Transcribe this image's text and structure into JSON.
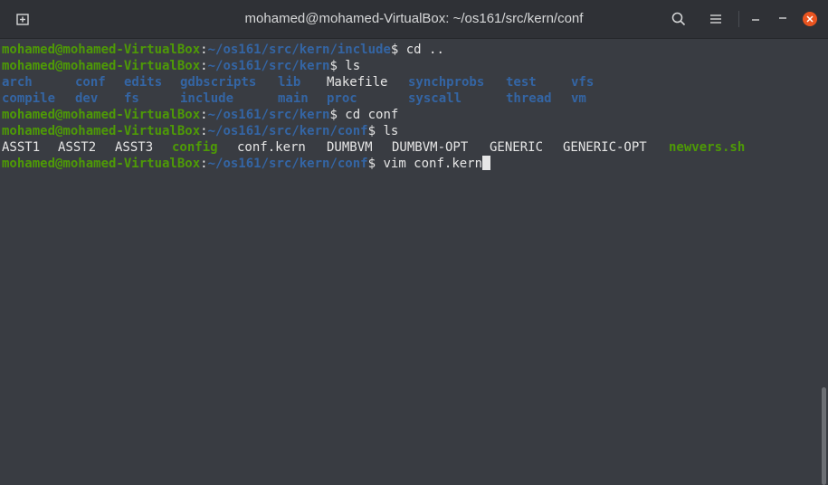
{
  "window": {
    "title": "mohamed@mohamed-VirtualBox: ~/os161/src/kern/conf"
  },
  "prompt": {
    "user_host": "mohamed@mohamed-VirtualBox",
    "sep": ":"
  },
  "lines": [
    {
      "path": "~/os161/src/kern/include",
      "cmd": "$ cd .."
    },
    {
      "path": "~/os161/src/kern",
      "cmd": "$ ls"
    },
    {
      "path": "~/os161/src/kern",
      "cmd": "$ cd conf"
    },
    {
      "path": "~/os161/src/kern/conf",
      "cmd": "$ ls"
    },
    {
      "path": "~/os161/src/kern/conf",
      "cmd": "$ vim conf.kern"
    }
  ],
  "ls_kern": {
    "row1": [
      "arch",
      "conf",
      "edits",
      "gdbscripts",
      "lib",
      "Makefile",
      "synchprobs",
      "test",
      "vfs"
    ],
    "row2": [
      "compile",
      "dev",
      "fs",
      "include",
      "main",
      "proc",
      "syscall",
      "thread",
      "vm"
    ]
  },
  "ls_conf": [
    "ASST1",
    "ASST2",
    "ASST3",
    "config",
    "conf.kern",
    "DUMBVM",
    "DUMBVM-OPT",
    "GENERIC",
    "GENERIC-OPT",
    "newvers.sh"
  ]
}
